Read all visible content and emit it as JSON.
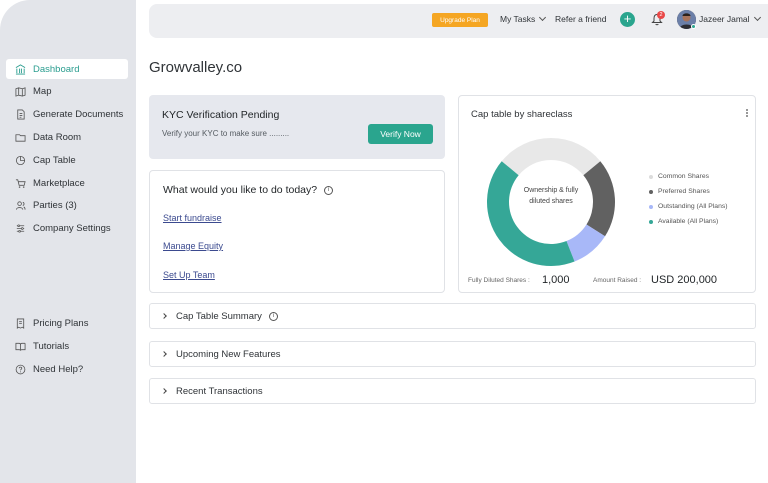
{
  "sidebar": {
    "items": [
      {
        "label": "Dashboard",
        "icon": "bank-icon"
      },
      {
        "label": "Map",
        "icon": "map-icon"
      },
      {
        "label": "Generate Documents",
        "icon": "document-icon"
      },
      {
        "label": "Data Room",
        "icon": "folder-icon"
      },
      {
        "label": "Cap Table",
        "icon": "pie-icon"
      },
      {
        "label": "Marketplace",
        "icon": "cart-icon"
      },
      {
        "label": "Parties (3)",
        "icon": "users-icon"
      },
      {
        "label": "Company Settings",
        "icon": "settings-icon"
      }
    ],
    "bottom_items": [
      {
        "label": "Pricing Plans",
        "icon": "receipt-icon"
      },
      {
        "label": "Tutorials",
        "icon": "book-icon"
      },
      {
        "label": "Need Help?",
        "icon": "help-icon"
      }
    ]
  },
  "header": {
    "upgrade_label": "Upgrade Plan",
    "my_tasks_label": "My Tasks",
    "refer_label": "Refer a friend",
    "notification_count": "2",
    "user_name": "Jazeer Jamal"
  },
  "main": {
    "company_name": "Growvalley.co",
    "kyc": {
      "title": "KYC Verification Pending",
      "subtitle": "Verify your KYC to make sure .........",
      "button_label": "Verify Now"
    },
    "todo": {
      "title": "What would you like to do today?",
      "links": [
        "Start fundraise",
        "Manage Equity",
        "Set Up Team"
      ]
    },
    "cap_table": {
      "title": "Cap table by shareclass",
      "center_label": "Ownership & fully diluted shares",
      "fully_diluted_label": "Fully Diluted Shares :",
      "fully_diluted_value": "1,000",
      "amount_raised_label": "Amount Raised :",
      "amount_raised_value": "USD 200,000"
    },
    "accordions": [
      "Cap Table Summary",
      "Upcoming New Features",
      "Recent Transactions"
    ]
  },
  "chart_data": {
    "type": "pie",
    "categories": [
      "Common Shares",
      "Preferred Shares",
      "Outstanding (All Plans)",
      "Available (All Plans)"
    ],
    "values": [
      28,
      20,
      10,
      42
    ],
    "colors": [
      "#e8e8e8",
      "#616161",
      "#a8b8f8",
      "#35a797"
    ]
  },
  "colors": {
    "accent": "#2aa58e",
    "upgrade": "#f5a623",
    "badge": "#e94848"
  }
}
